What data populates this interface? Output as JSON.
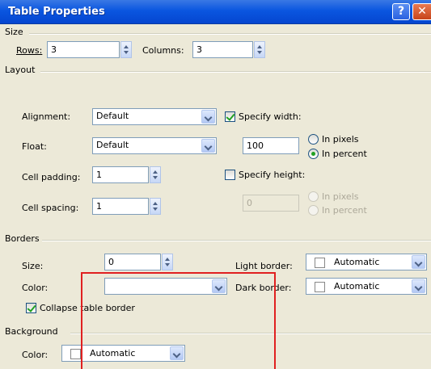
{
  "window": {
    "title": "Table Properties",
    "help_label": "?",
    "close_label": "✕"
  },
  "size": {
    "section_label": "Size",
    "rows_label": "Rows:",
    "rows_value": "3",
    "columns_label": "Columns:",
    "columns_value": "3"
  },
  "layout": {
    "section_label": "Layout",
    "alignment_label": "Alignment:",
    "alignment_value": "Default",
    "float_label": "Float:",
    "float_value": "Default",
    "cell_padding_label": "Cell padding:",
    "cell_padding_value": "1",
    "cell_spacing_label": "Cell spacing:",
    "cell_spacing_value": "1",
    "specify_width_label": "Specify width:",
    "specify_width_checked": true,
    "width_value": "100",
    "width_pixels_label": "In pixels",
    "width_percent_label": "In percent",
    "specify_height_label": "Specify height:",
    "specify_height_checked": false,
    "height_value": "0",
    "height_pixels_label": "In pixels",
    "height_percent_label": "In percent"
  },
  "borders": {
    "section_label": "Borders",
    "size_label": "Size:",
    "size_value": "0",
    "color_label": "Color:",
    "color_value": "",
    "light_border_label": "Light border:",
    "light_border_value": "Automatic",
    "dark_border_label": "Dark border:",
    "dark_border_value": "Automatic",
    "collapse_label": "Collapse table border",
    "collapse_checked": true
  },
  "background": {
    "section_label": "Background",
    "color_label": "Color:",
    "color_value": "Automatic"
  },
  "colors": {
    "highlight_box": "#e02020",
    "title_bar": "#0a56e0"
  }
}
